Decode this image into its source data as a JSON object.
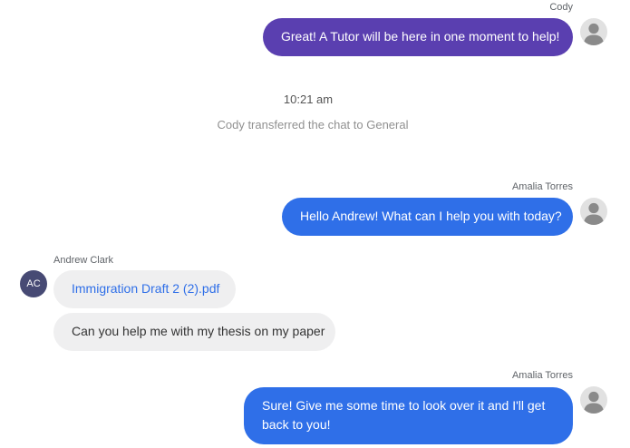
{
  "colors": {
    "agent_bubble": "#5a3fb0",
    "tutor_bubble": "#2f6fe8",
    "student_bubble": "#efeff0",
    "initials_avatar": "#474a74",
    "link": "#2f6fe8"
  },
  "messages": [
    {
      "sender": "Cody",
      "text": "Great! A Tutor will be here in one moment to help!",
      "avatar_icon": "user-silhouette-icon"
    },
    {
      "sender": "Amalia Torres",
      "text": "Hello Andrew! What can I help you with today?",
      "avatar_icon": "user-silhouette-icon"
    },
    {
      "sender": "Andrew Clark",
      "avatar_initials": "AC",
      "attachment": "Immigration Draft 2 (2).pdf",
      "text": "Can you help me with my thesis on my paper"
    },
    {
      "sender": "Amalia Torres",
      "text": "Sure! Give me some time to look over it and I'll get back to you!",
      "avatar_icon": "user-silhouette-icon"
    }
  ],
  "system": {
    "time": "10:21 am",
    "transfer_notice": "Cody transferred the chat to General"
  }
}
